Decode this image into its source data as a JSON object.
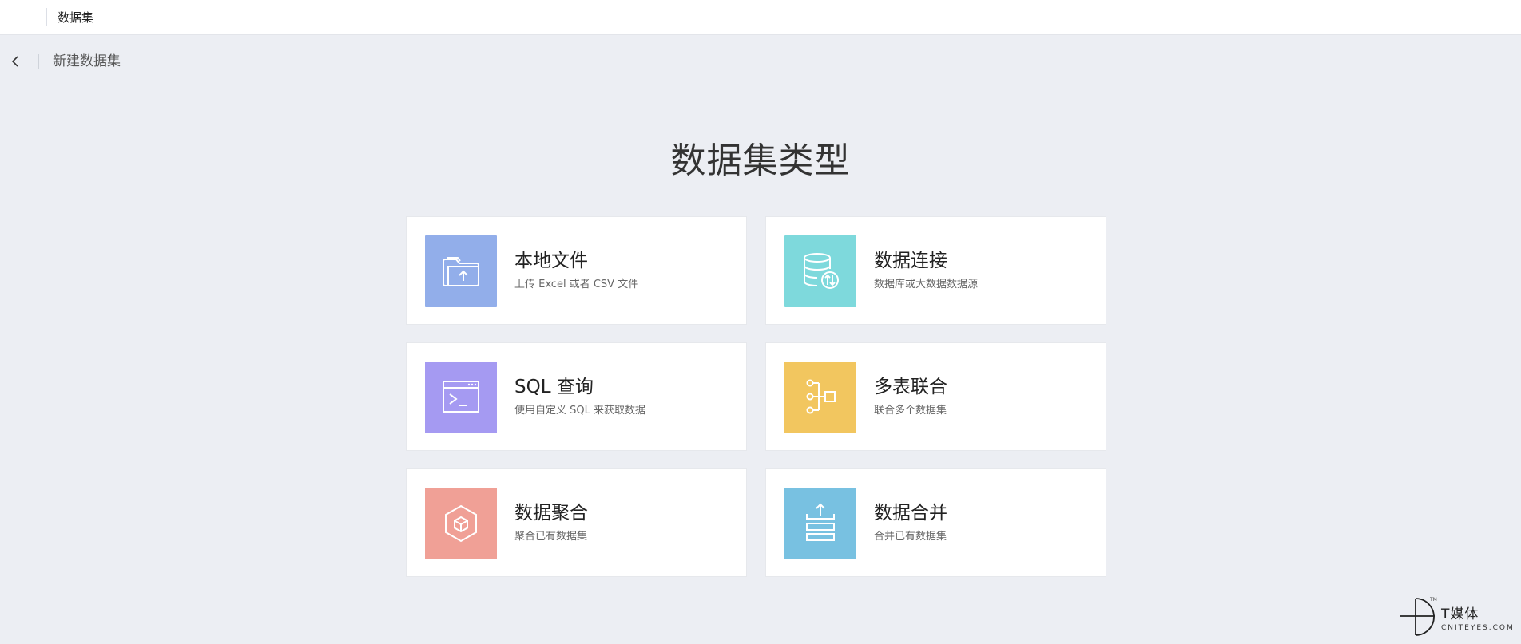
{
  "topbar": {
    "title": "数据集"
  },
  "subheader": {
    "title": "新建数据集"
  },
  "page": {
    "title": "数据集类型"
  },
  "cards": [
    {
      "name": "本地文件",
      "desc": "上传 Excel 或者 CSV 文件",
      "icon": "folder-upload-icon",
      "color": "#92aeea"
    },
    {
      "name": "数据连接",
      "desc": "数据库或大数据数据源",
      "icon": "database-connect-icon",
      "color": "#7ed9dc"
    },
    {
      "name": "SQL 查询",
      "desc": "使用自定义 SQL 来获取数据",
      "icon": "terminal-icon",
      "color": "#a59af2"
    },
    {
      "name": "多表联合",
      "desc": "联合多个数据集",
      "icon": "tree-join-icon",
      "color": "#f2c65f"
    },
    {
      "name": "数据聚合",
      "desc": "聚合已有数据集",
      "icon": "cube-aggregate-icon",
      "color": "#f0a096"
    },
    {
      "name": "数据合并",
      "desc": "合并已有数据集",
      "icon": "stack-merge-icon",
      "color": "#78c1e1"
    }
  ],
  "watermark": {
    "brand": "T媒体",
    "domain": "CNITEYES.COM",
    "tm": "TM"
  }
}
